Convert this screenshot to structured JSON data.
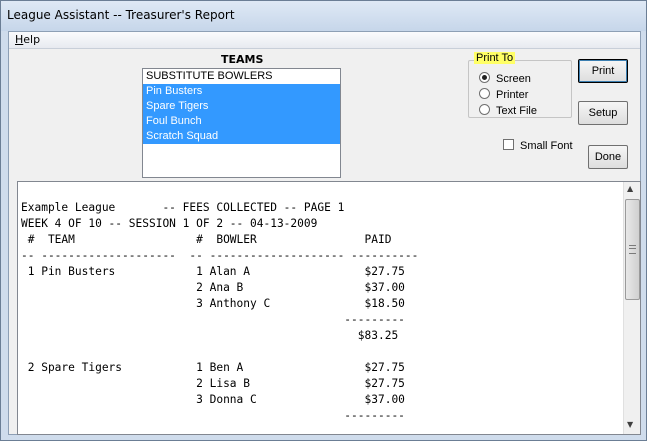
{
  "window": {
    "title": "League Assistant -- Treasurer's Report"
  },
  "menu": {
    "help": "Help"
  },
  "teams": {
    "label": "TEAMS",
    "items": [
      {
        "label": "SUBSTITUTE BOWLERS",
        "selected": false
      },
      {
        "label": "Pin Busters",
        "selected": true
      },
      {
        "label": "Spare Tigers",
        "selected": true
      },
      {
        "label": "Foul Bunch",
        "selected": true
      },
      {
        "label": "Scratch Squad",
        "selected": true
      }
    ]
  },
  "print_to": {
    "title": "Print To",
    "options": [
      {
        "label": "Screen",
        "checked": true
      },
      {
        "label": "Printer",
        "checked": false
      },
      {
        "label": "Text File",
        "checked": false
      }
    ]
  },
  "buttons": {
    "print": "Print",
    "setup": "Setup",
    "done": "Done"
  },
  "small_font": {
    "label": "Small Font",
    "checked": false
  },
  "report": {
    "lines": [
      "Example League       -- FEES COLLECTED -- PAGE 1",
      "WEEK 4 OF 10 -- SESSION 1 OF 2 -- 04-13-2009",
      " #  TEAM                  #  BOWLER                PAID",
      "-- --------------------  -- -------------------- ----------",
      " 1 Pin Busters            1 Alan A                 $27.75",
      "                          2 Ana B                  $37.00",
      "                          3 Anthony C              $18.50",
      "                                                ---------",
      "                                                  $83.25",
      "",
      " 2 Spare Tigers           1 Ben A                  $27.75",
      "                          2 Lisa B                 $27.75",
      "                          3 Donna C                $37.00",
      "                                                ---------"
    ]
  }
}
